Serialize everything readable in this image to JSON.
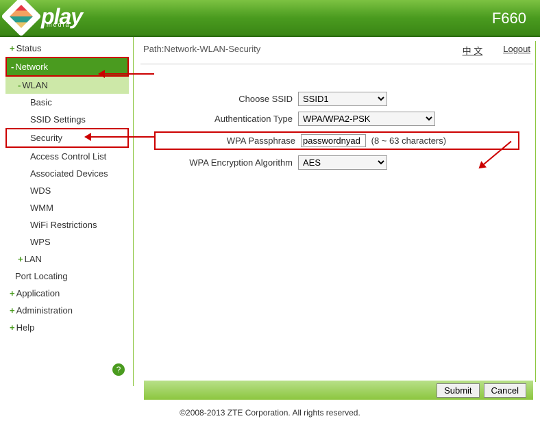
{
  "header": {
    "logo_text": "play",
    "logo_sub": "media",
    "model": "F660"
  },
  "path": {
    "label": "Path:Network-WLAN-Security",
    "lang": "中 文",
    "logout": "Logout"
  },
  "sidebar": {
    "status": "Status",
    "network": "Network",
    "wlan": "WLAN",
    "items": [
      "Basic",
      "SSID Settings",
      "Security",
      "Access Control List",
      "Associated Devices",
      "WDS",
      "WMM",
      "WiFi Restrictions",
      "WPS"
    ],
    "lan": "LAN",
    "port": "Port Locating",
    "app": "Application",
    "admin": "Administration",
    "help": "Help",
    "help_icon": "?"
  },
  "form": {
    "ssid_label": "Choose SSID",
    "ssid_value": "SSID1",
    "auth_label": "Authentication Type",
    "auth_value": "WPA/WPA2-PSK",
    "pass_label": "WPA Passphrase",
    "pass_value": "passwordnyad",
    "pass_hint": "(8 ~ 63 characters)",
    "enc_label": "WPA Encryption Algorithm",
    "enc_value": "AES"
  },
  "buttons": {
    "submit": "Submit",
    "cancel": "Cancel"
  },
  "footer": "©2008-2013 ZTE Corporation. All rights reserved."
}
